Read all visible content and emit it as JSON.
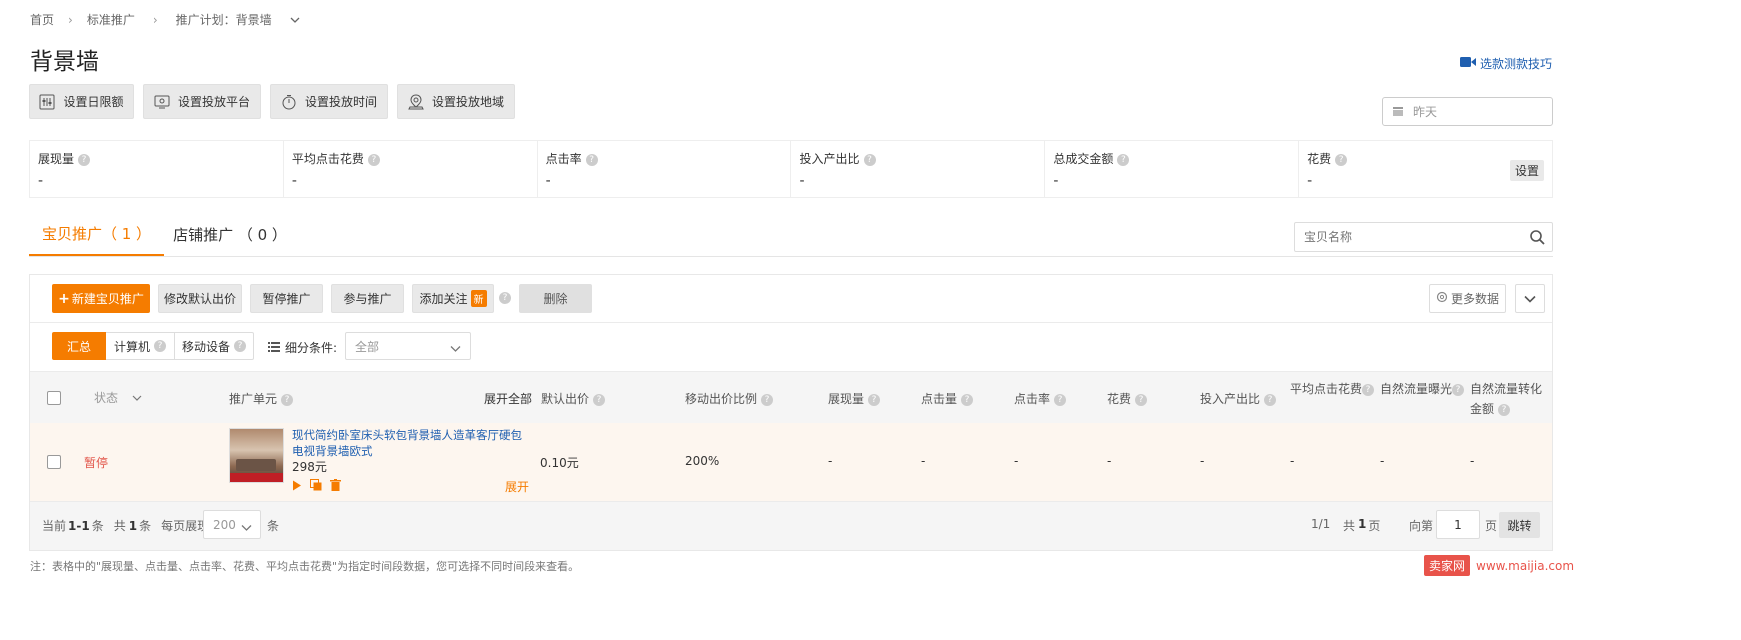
{
  "breadcrumb": {
    "home": "首页",
    "standard": "标准推广",
    "plan_prefix": "推广计划：",
    "plan_name": "背景墙"
  },
  "page_title": "背景墙",
  "video_tip": "选款测款技巧",
  "toolbar": {
    "daily_limit": "设置日限额",
    "platform": "设置投放平台",
    "time": "设置投放时间",
    "region": "设置投放地域"
  },
  "date_picker": {
    "value": "昨天"
  },
  "metrics": [
    {
      "label": "展现量",
      "value": "-"
    },
    {
      "label": "平均点击花费",
      "value": "-"
    },
    {
      "label": "点击率",
      "value": "-"
    },
    {
      "label": "投入产出比",
      "value": "-"
    },
    {
      "label": "总成交金额",
      "value": "-"
    },
    {
      "label": "花费",
      "value": "-"
    }
  ],
  "metrics_settings": "设置",
  "tabs": {
    "item_promo": "宝贝推广（ 1 ）",
    "shop_promo": "店铺推广 （ 0 ）"
  },
  "search": {
    "placeholder": "宝贝名称"
  },
  "actions": {
    "new_item": "新建宝贝推广",
    "modify_bid": "修改默认出价",
    "pause": "暂停推广",
    "join": "参与推广",
    "add_follow": "添加关注",
    "new_badge": "新",
    "delete": "删除",
    "more_data": "更多数据"
  },
  "filters": {
    "summary": "汇总",
    "computer": "计算机",
    "mobile": "移动设备",
    "segment_label": "细分条件:",
    "segment_value": "全部"
  },
  "table": {
    "headers": {
      "status": "状态",
      "unit": "推广单元",
      "expand_all": "展开全部",
      "default_bid": "默认出价",
      "mobile_ratio": "移动出价比例",
      "impressions": "展现量",
      "clicks": "点击量",
      "ctr": "点击率",
      "cost": "花费",
      "roi": "投入产出比",
      "avg_cpc": "平均点击花费",
      "natural_exposure": "自然流量曝光",
      "natural_conversion": "自然流量转化金额"
    },
    "rows": [
      {
        "status": "暂停",
        "title": "现代简约卧室床头软包背景墙人造革客厅硬包电视背景墙欧式",
        "price": "298元",
        "expand": "展开",
        "default_bid": "0.10元",
        "mobile_ratio": "200%",
        "impressions": "-",
        "clicks": "-",
        "ctr": "-",
        "cost": "-",
        "roi": "-",
        "avg_cpc": "-",
        "natural_exposure": "-",
        "natural_conversion": "-"
      }
    ]
  },
  "pagination": {
    "current_prefix": "当前",
    "current_range": "1-1",
    "current_suffix": "条",
    "total_prefix": "共",
    "total": "1",
    "total_suffix": "条",
    "per_page_label": "每页展现",
    "per_page": "200",
    "per_page_suffix": "条",
    "page_info": "1/1",
    "pages_prefix": "共",
    "pages": "1",
    "pages_suffix": "页",
    "goto_label": "向第",
    "goto_value": "1",
    "goto_suffix": "页",
    "jump": "跳转"
  },
  "footnote": "注：表格中的\"展现量、点击量、点击率、花费、平均点击花费\"为指定时间段数据，您可选择不同时间段来查看。",
  "watermark": {
    "brand": "卖家网",
    "url": "www.maijia.com"
  },
  "colors": {
    "accent": "#f57c00",
    "link": "#1f5fb0",
    "row_bg": "#fdf6ef",
    "paused": "#e2554a"
  }
}
